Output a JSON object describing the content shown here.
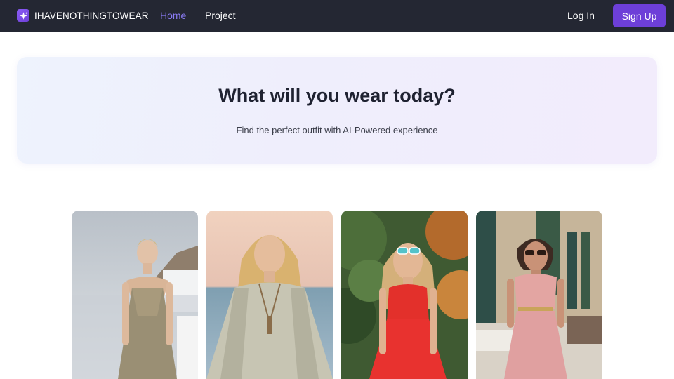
{
  "navbar": {
    "brand": "IHAVENOTHINGTOWEAR",
    "links": [
      {
        "label": "Home",
        "active": true
      },
      {
        "label": "Project",
        "active": false
      }
    ],
    "login_label": "Log In",
    "signup_label": "Sign Up"
  },
  "hero": {
    "title": "What will you wear today?",
    "subtitle": "Find the perfect outfit with AI-Powered experience"
  },
  "gallery": {
    "items": [
      {
        "icon": "outfit-photo",
        "dress_color": "#9a8f74"
      },
      {
        "icon": "outfit-photo",
        "dress_color": "#b9b7a6"
      },
      {
        "icon": "outfit-photo",
        "dress_color": "#e8322f"
      },
      {
        "icon": "outfit-photo",
        "dress_color": "#e0a0a0"
      }
    ]
  },
  "colors": {
    "nav_bg": "#242733",
    "accent": "#6d3fd8",
    "active_link": "#8b7cf6"
  }
}
